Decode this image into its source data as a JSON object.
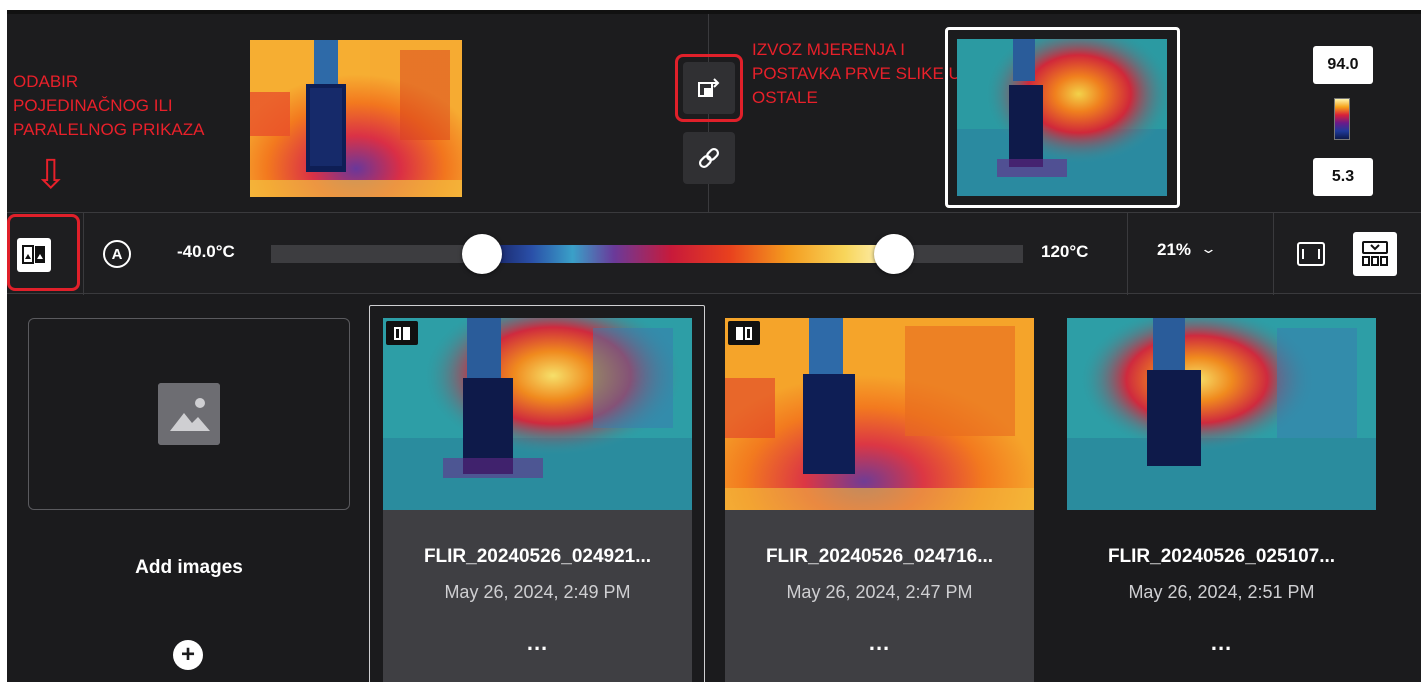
{
  "annotations": {
    "view_mode_lines": [
      "ODABIR",
      "POJEDINAČNOG ILI",
      "PARALELNOG PRIKAZA"
    ],
    "arrow": "⇩",
    "export_lines": [
      "IZVOZ MJERENJA I",
      "POSTAVKA PRVE SLIKE U",
      "OSTALE"
    ],
    "color": "#e8202a"
  },
  "comparison": {
    "max_value": "94.0",
    "min_value": "5.3"
  },
  "toolbar": {
    "auto_label": "A",
    "temp_min": "-40.0°C",
    "temp_max": "120°C",
    "range_low_fraction": 0.281,
    "range_high_fraction": 0.829,
    "zoom": "21%",
    "chevron": "⌵"
  },
  "gallery": {
    "add_label": "Add images",
    "add_plus": "+",
    "cards": [
      {
        "name": "FLIR_20240526_024921...",
        "date": "May 26, 2024, 2:49 PM",
        "more": "...",
        "palette": "rainbow"
      },
      {
        "name": "FLIR_20240526_024716...",
        "date": "May 26, 2024, 2:47 PM",
        "more": "...",
        "palette": "iron"
      },
      {
        "name": "FLIR_20240526_025107...",
        "date": "May 26, 2024, 2:51 PM",
        "more": "...",
        "palette": "rainbow"
      }
    ]
  },
  "colors": {
    "accent_annotation": "#e8202a",
    "background": "#1b1b1d",
    "card_info": "#3f3f43"
  }
}
